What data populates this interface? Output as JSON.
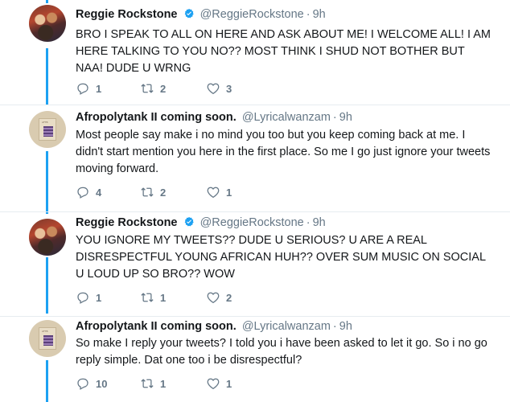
{
  "tweets": [
    {
      "name": "Reggie Rockstone",
      "handle": "@ReggieRockstone",
      "time": "9h",
      "verified": true,
      "avatar_icon": "reggie-avatar",
      "text": "BRO I SPEAK TO ALL ON HERE AND ASK ABOUT ME! I WELCOME ALL! I AM HERE TALKING TO YOU NO?? MOST THINK I SHUD NOT BOTHER BUT NAA! DUDE U WRNG",
      "replies": "1",
      "retweets": "2",
      "likes": "3"
    },
    {
      "name": "Afropolytank II coming soon.",
      "handle": "@Lyricalwanzam",
      "time": "9h",
      "verified": false,
      "avatar_icon": "album-cover-avatar",
      "text": "Most people say make i no mind you too but you keep coming back at me. I didn't start mention you here in the first place. So me I go just ignore your tweets moving forward.",
      "replies": "4",
      "retweets": "2",
      "likes": "1"
    },
    {
      "name": "Reggie Rockstone",
      "handle": "@ReggieRockstone",
      "time": "9h",
      "verified": true,
      "avatar_icon": "reggie-avatar",
      "text": "YOU IGNORE MY TWEETS?? DUDE U SERIOUS? U ARE A REAL DISRESPECTFUL YOUNG AFRICAN HUH?? OVER SUM MUSIC ON SOCIAL U LOUD UP SO BRO?? WOW",
      "replies": "1",
      "retweets": "1",
      "likes": "2"
    },
    {
      "name": "Afropolytank II coming soon.",
      "handle": "@Lyricalwanzam",
      "time": "9h",
      "verified": false,
      "avatar_icon": "album-cover-avatar",
      "text": "So make I reply your tweets? I told you i have been asked to let it go. So i no go reply simple. Dat one too i be disrespectful?",
      "replies": "10",
      "retweets": "1",
      "likes": "1"
    }
  ],
  "colors": {
    "thread_line": "#1da1f2",
    "verified": "#1da1f2",
    "muted": "#657786",
    "divider": "#e6ecf0"
  },
  "icons": {
    "reply": "reply-icon",
    "retweet": "retweet-icon",
    "like": "heart-icon",
    "verified": "verified-badge-icon"
  }
}
